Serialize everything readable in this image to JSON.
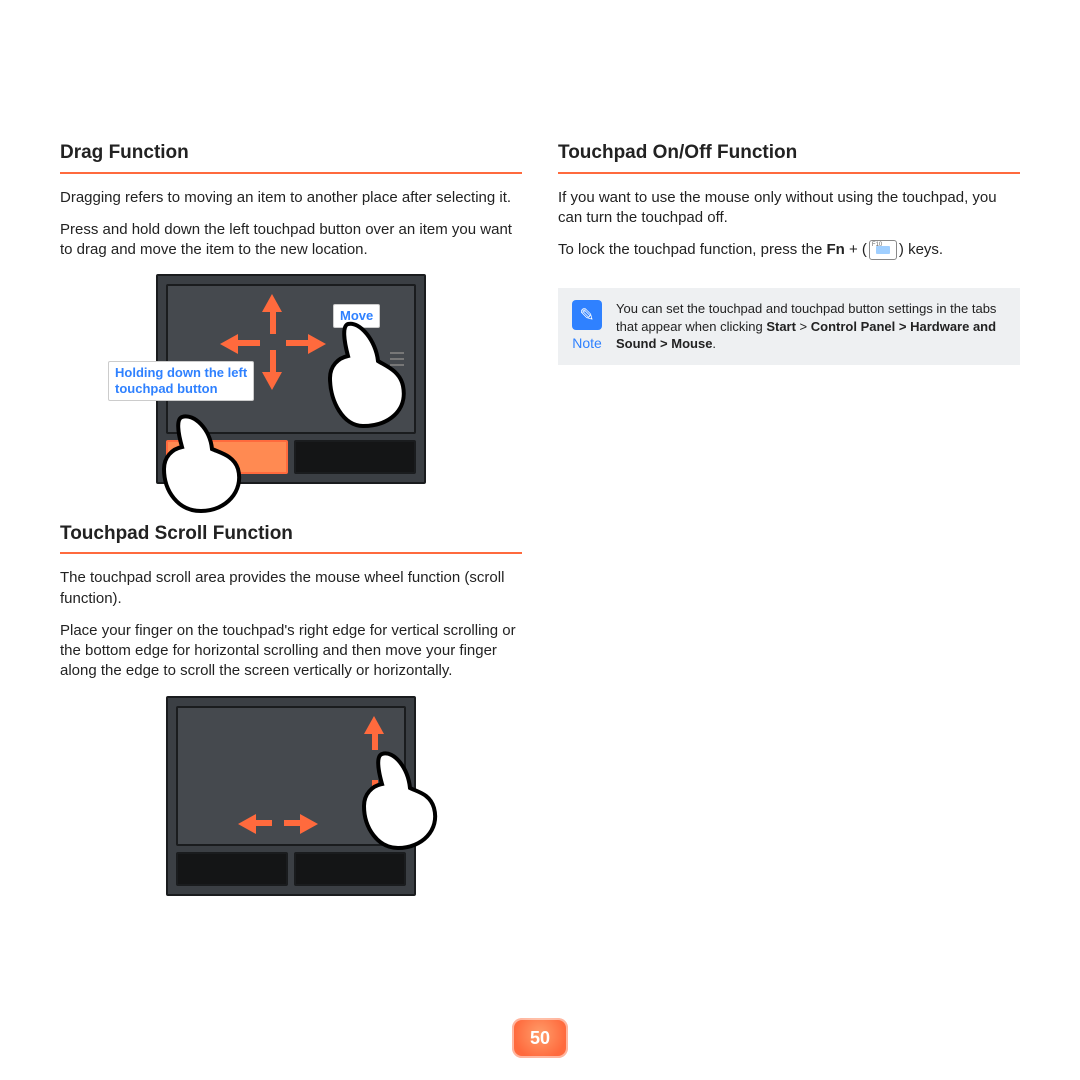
{
  "page_number": "50",
  "left": {
    "drag": {
      "heading": "Drag Function",
      "p1": "Dragging refers to moving an item to another place after selecting it.",
      "p2": "Press and hold down the left touchpad button over an item you want to drag and move the item to the new location.",
      "label_hold_line1": "Holding down the left",
      "label_hold_line2": "touchpad button",
      "label_move": "Move"
    },
    "scroll": {
      "heading": "Touchpad Scroll Function",
      "p1": "The touchpad scroll area provides the mouse wheel function (scroll function).",
      "p2": "Place your finger on the touchpad's right edge for vertical scrolling or the bottom edge for horizontal scrolling and then move your finger along the edge to scroll the screen vertically or horizontally."
    }
  },
  "right": {
    "onoff": {
      "heading": "Touchpad On/Off Function",
      "p1": "If you want to use the mouse only without using the touchpad, you can turn the touchpad off.",
      "p2a": "To lock the touchpad function, press the ",
      "p2_fn": "Fn",
      "p2b": " + (",
      "key_label": "F10",
      "p2c": ") keys."
    },
    "note": {
      "label": "Note",
      "text_a": "You can set the touchpad and touchpad button settings in the tabs that appear when clicking ",
      "start": "Start",
      "gt1": " > ",
      "path": "Control Panel > Hardware and Sound > Mouse",
      "period": "."
    }
  }
}
